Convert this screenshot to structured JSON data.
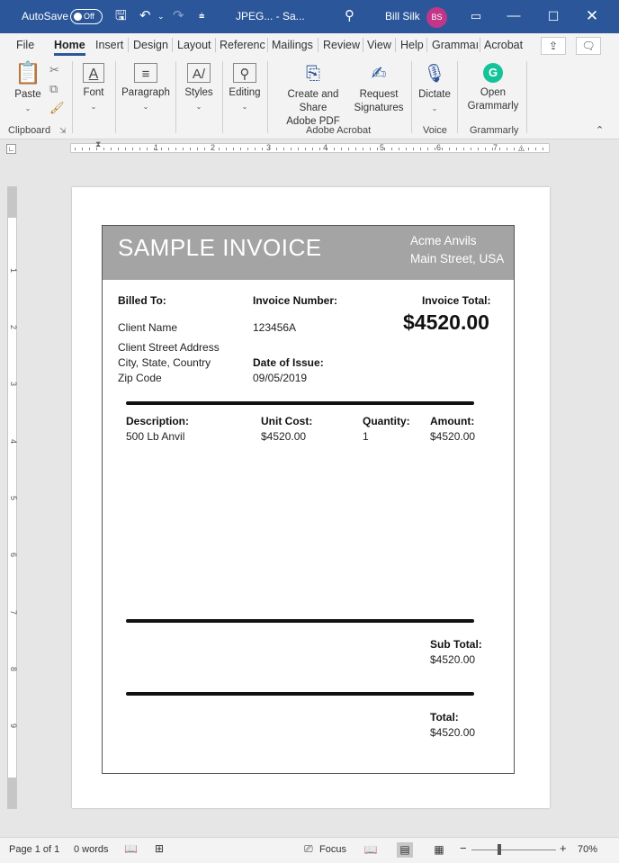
{
  "titlebar": {
    "autosave_label": "AutoSave",
    "autosave_state": "Off",
    "doc_title": "JPEG... - Sa...",
    "user_name": "Bill Silk",
    "user_initials": "BS"
  },
  "tabs": [
    "File",
    "Home",
    "Insert",
    "Design",
    "Layout",
    "Referenc",
    "Mailings",
    "Review",
    "View",
    "Help",
    "Grammaı",
    "Acrobat"
  ],
  "ribbon": {
    "paste": "Paste",
    "font": "Font",
    "paragraph": "Paragraph",
    "styles": "Styles",
    "editing": "Editing",
    "create_share_1": "Create and Share",
    "create_share_2": "Adobe PDF",
    "request_sig_1": "Request",
    "request_sig_2": "Signatures",
    "dictate": "Dictate",
    "open_grammarly_1": "Open",
    "open_grammarly_2": "Grammarly",
    "groups": {
      "clipboard": "Clipboard",
      "adobe_acrobat": "Adobe Acrobat",
      "voice": "Voice",
      "grammarly": "Grammarly"
    }
  },
  "ruler": {
    "numbers": [
      "1",
      "2",
      "3",
      "4",
      "5",
      "6",
      "7"
    ],
    "vnumbers": [
      "1",
      "2",
      "3",
      "4",
      "5",
      "6",
      "7",
      "8",
      "9"
    ]
  },
  "invoice": {
    "title": "SAMPLE INVOICE",
    "company_name": "Acme Anvils",
    "company_address": "Main Street, USA",
    "billed_to_label": "Billed To:",
    "client_name": "Client Name",
    "client_street": "Client Street Address",
    "client_city": "City, State, Country",
    "client_zip": "Zip Code",
    "invoice_number_label": "Invoice Number:",
    "invoice_number": "123456A",
    "date_label": "Date of Issue:",
    "date": "09/05/2019",
    "invoice_total_label": "Invoice Total:",
    "invoice_total": "$4520.00",
    "columns": {
      "description": "Description:",
      "unit_cost": "Unit Cost:",
      "quantity": "Quantity:",
      "amount": "Amount:"
    },
    "item": {
      "description": "500 Lb Anvil",
      "unit_cost": "$4520.00",
      "quantity": "1",
      "amount": "$4520.00"
    },
    "subtotal_label": "Sub Total:",
    "subtotal": "$4520.00",
    "total_label": "Total:",
    "total": "$4520.00"
  },
  "statusbar": {
    "page": "Page 1 of 1",
    "words": "0 words",
    "focus": "Focus",
    "zoom": "70%"
  },
  "colors": {
    "titlebar": "#2b579a",
    "invoice_header": "#a4a4a4",
    "avatar": "#c2368a",
    "grammarly": "#15c39a"
  }
}
